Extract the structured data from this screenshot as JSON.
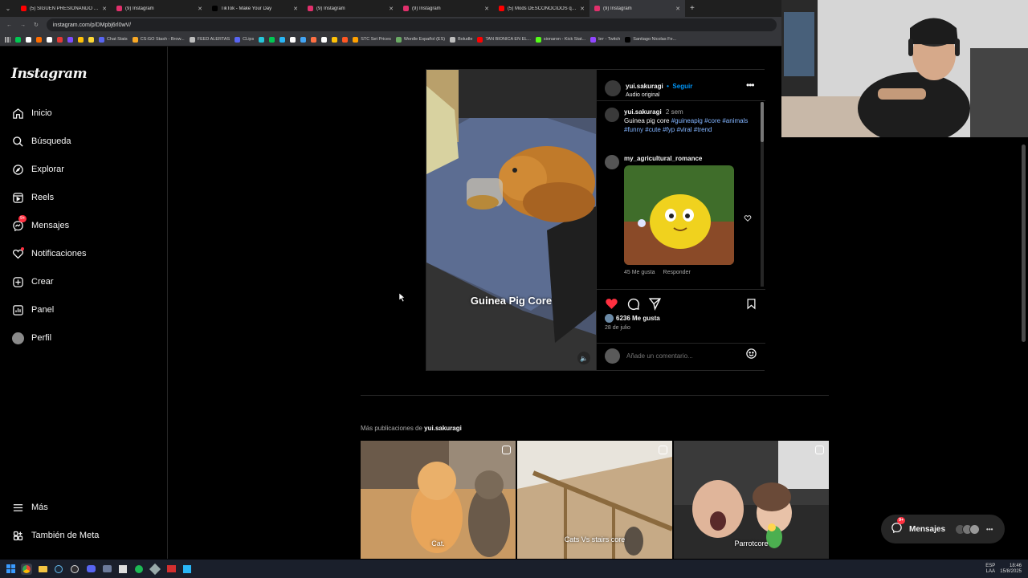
{
  "browser": {
    "tabs": [
      {
        "title": "(5) SIGUEN PRESIONANDO A S",
        "color": "#ff0000"
      },
      {
        "title": "(9) Instagram",
        "color": "#e1306c"
      },
      {
        "title": "TikTok - Make Your Day",
        "color": "#000000"
      },
      {
        "title": "(9) Instagram",
        "color": "#e1306c"
      },
      {
        "title": "(9) Instagram",
        "color": "#e1306c"
      },
      {
        "title": "(5) Mods DESCONOCIDOS que",
        "color": "#ff0000"
      },
      {
        "title": "(9) Instagram",
        "color": "#e1306c",
        "active": true
      }
    ],
    "url": "instagram.com/p/DMpbj6rl0wV/",
    "bookmarks": [
      {
        "label": "",
        "color": "#00c853"
      },
      {
        "label": "",
        "color": "#ffffff"
      },
      {
        "label": "",
        "color": "#ff6d00"
      },
      {
        "label": "",
        "color": "#ffffff"
      },
      {
        "label": "",
        "color": "#e53935"
      },
      {
        "label": "",
        "color": "#7c4dff"
      },
      {
        "label": "",
        "color": "#ffc107"
      },
      {
        "label": "",
        "color": "#fdd835"
      },
      {
        "label": "Chat Stats",
        "color": "#5865f2"
      },
      {
        "label": "CS:GO Stash - Brow...",
        "color": "#f9a825"
      },
      {
        "label": "FEED ALERTAS",
        "color": "#bdbdbd"
      },
      {
        "label": "CLips",
        "color": "#5865f2"
      },
      {
        "label": "",
        "color": "#26c6da"
      },
      {
        "label": "",
        "color": "#00c853"
      },
      {
        "label": "",
        "color": "#29b6f6"
      },
      {
        "label": "",
        "color": "#ffffff"
      },
      {
        "label": "",
        "color": "#42a5f5"
      },
      {
        "label": "",
        "color": "#ff7043"
      },
      {
        "label": "",
        "color": "#ffffff"
      },
      {
        "label": "",
        "color": "#ffc107"
      },
      {
        "label": "",
        "color": "#ff5722"
      },
      {
        "label": "STC Set Prices",
        "color": "#ffa000"
      },
      {
        "label": "Wordle Español (ES)",
        "color": "#6aaa64"
      },
      {
        "label": "Boludle",
        "color": "#bdbdbd"
      },
      {
        "label": "TAN BIONICA EN EL...",
        "color": "#ff0000"
      },
      {
        "label": "sionaron - Kick Stat...",
        "color": "#53fc18"
      },
      {
        "label": "brr - Twitch",
        "color": "#9146ff"
      },
      {
        "label": "Santiago Nicolas Fe...",
        "color": "#000000"
      }
    ]
  },
  "sidebar": {
    "logo": "Instagram",
    "items": [
      {
        "label": "Inicio",
        "icon": "home-icon"
      },
      {
        "label": "Búsqueda",
        "icon": "search-icon"
      },
      {
        "label": "Explorar",
        "icon": "compass-icon"
      },
      {
        "label": "Reels",
        "icon": "reels-icon"
      },
      {
        "label": "Mensajes",
        "icon": "messenger-icon",
        "badge": "9+"
      },
      {
        "label": "Notificaciones",
        "icon": "heart-icon"
      },
      {
        "label": "Crear",
        "icon": "plus-square-icon"
      },
      {
        "label": "Panel",
        "icon": "panel-icon"
      },
      {
        "label": "Perfil",
        "icon": "avatar"
      }
    ],
    "more": "Más",
    "meta": "También de Meta"
  },
  "post": {
    "author": "yui.sakuragi",
    "follow": "Seguir",
    "audio": "Audio original",
    "video_caption": "Guinea Pig Core",
    "caption": {
      "author": "yui.sakuragi",
      "time": "2 sem",
      "text": "Guinea pig core",
      "tags": [
        "#guineapig",
        "#core",
        "#animals",
        "#funny",
        "#cute",
        "#fyp",
        "#viral",
        "#trend"
      ]
    },
    "comment": {
      "author": "my_agricultural_romance",
      "likes": "45 Me gusta",
      "reply": "Responder"
    },
    "likes": "6236 Me gusta",
    "date": "28 de julio",
    "comment_placeholder": "Añade un comentario..."
  },
  "more_posts": {
    "prefix": "Más publicaciones de",
    "author": "yui.sakuragi",
    "items": [
      {
        "caption": "Cat."
      },
      {
        "caption": "Cats Vs stairs core"
      },
      {
        "caption": "Parrotcore"
      }
    ]
  },
  "messages_pill": {
    "label": "Mensajes",
    "badge": "9+"
  },
  "taskbar": {
    "lang": "ESP\nLAA",
    "time": "18:46",
    "date": "15/8/2025"
  },
  "colors": {
    "accent": "#0095f6",
    "like": "#ff3040"
  }
}
